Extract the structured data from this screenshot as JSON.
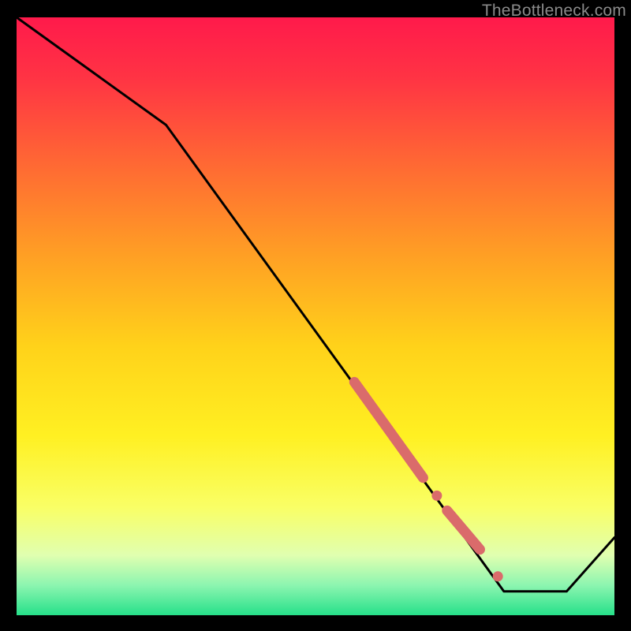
{
  "watermark": "TheBottleneck.com",
  "colors": {
    "stroke": "#000000",
    "marker": "#da6b6b",
    "gradient_stops": [
      {
        "offset": 0.0,
        "color": "#ff1a4b"
      },
      {
        "offset": 0.1,
        "color": "#ff3344"
      },
      {
        "offset": 0.25,
        "color": "#ff6a33"
      },
      {
        "offset": 0.4,
        "color": "#ffa024"
      },
      {
        "offset": 0.55,
        "color": "#ffd21a"
      },
      {
        "offset": 0.7,
        "color": "#fff022"
      },
      {
        "offset": 0.82,
        "color": "#f9ff66"
      },
      {
        "offset": 0.9,
        "color": "#e0ffb0"
      },
      {
        "offset": 0.95,
        "color": "#8cf5b0"
      },
      {
        "offset": 1.0,
        "color": "#26e08a"
      }
    ]
  },
  "chart_data": {
    "type": "line",
    "title": "",
    "xlabel": "",
    "ylabel": "",
    "xlim": [
      0,
      100
    ],
    "ylim": [
      0,
      100
    ],
    "note": "Axes are not labeled; values below are percentages of the plot area (origin at bottom-left), estimated from pixel positions.",
    "series": [
      {
        "name": "curve",
        "x": [
          0.0,
          25.0,
          81.5,
          92.0,
          100.0
        ],
        "y": [
          100.0,
          82.0,
          4.0,
          4.0,
          13.0
        ]
      }
    ],
    "markers": [
      {
        "name": "highlight-band-upper",
        "style": "thick-segment",
        "x": [
          56.5,
          68.0
        ],
        "y": [
          39.0,
          23.0
        ]
      },
      {
        "name": "highlight-dot-mid",
        "style": "dot",
        "x": [
          70.3
        ],
        "y": [
          20.0
        ]
      },
      {
        "name": "highlight-band-lower",
        "style": "thick-segment",
        "x": [
          72.0,
          77.5
        ],
        "y": [
          17.5,
          11.0
        ]
      },
      {
        "name": "highlight-dot-low",
        "style": "dot",
        "x": [
          80.5
        ],
        "y": [
          6.5
        ]
      }
    ]
  }
}
